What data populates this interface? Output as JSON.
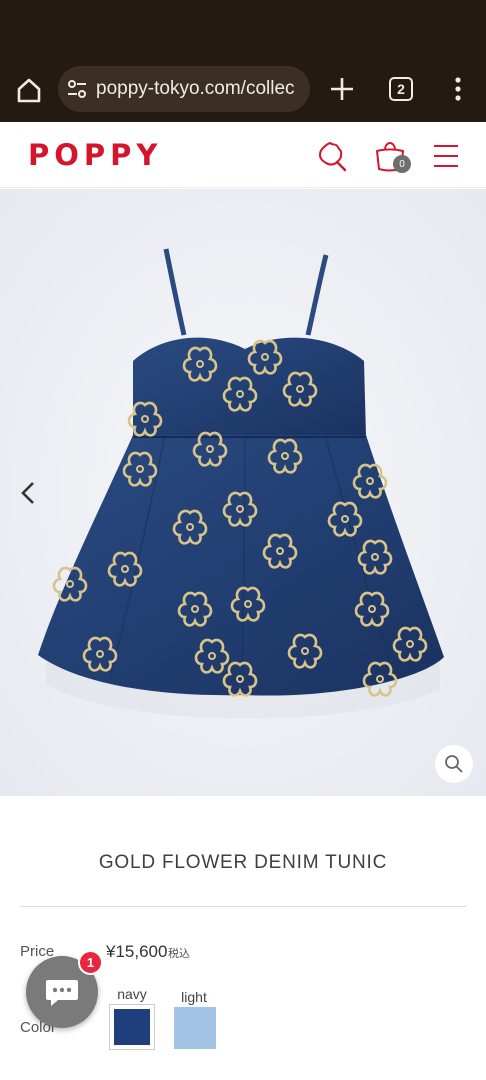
{
  "browser": {
    "url": "poppy-tokyo.com/collec",
    "tab_count": "2"
  },
  "header": {
    "logo": "POPPY",
    "cart_count": "0",
    "accent_color": "#d5152b"
  },
  "gallery": {
    "icons": [
      "chevron-left-icon",
      "zoom-icon"
    ]
  },
  "product": {
    "title": "GOLD FLOWER DENIM TUNIC",
    "price_label": "Price",
    "price": "¥15,600",
    "tax_note": "税込",
    "color_label": "Color",
    "colors": [
      {
        "name": "navy",
        "hex": "#1f3f7c"
      },
      {
        "name": "light",
        "hex": "#a2c3e4"
      }
    ]
  },
  "chat": {
    "badge": "1"
  }
}
